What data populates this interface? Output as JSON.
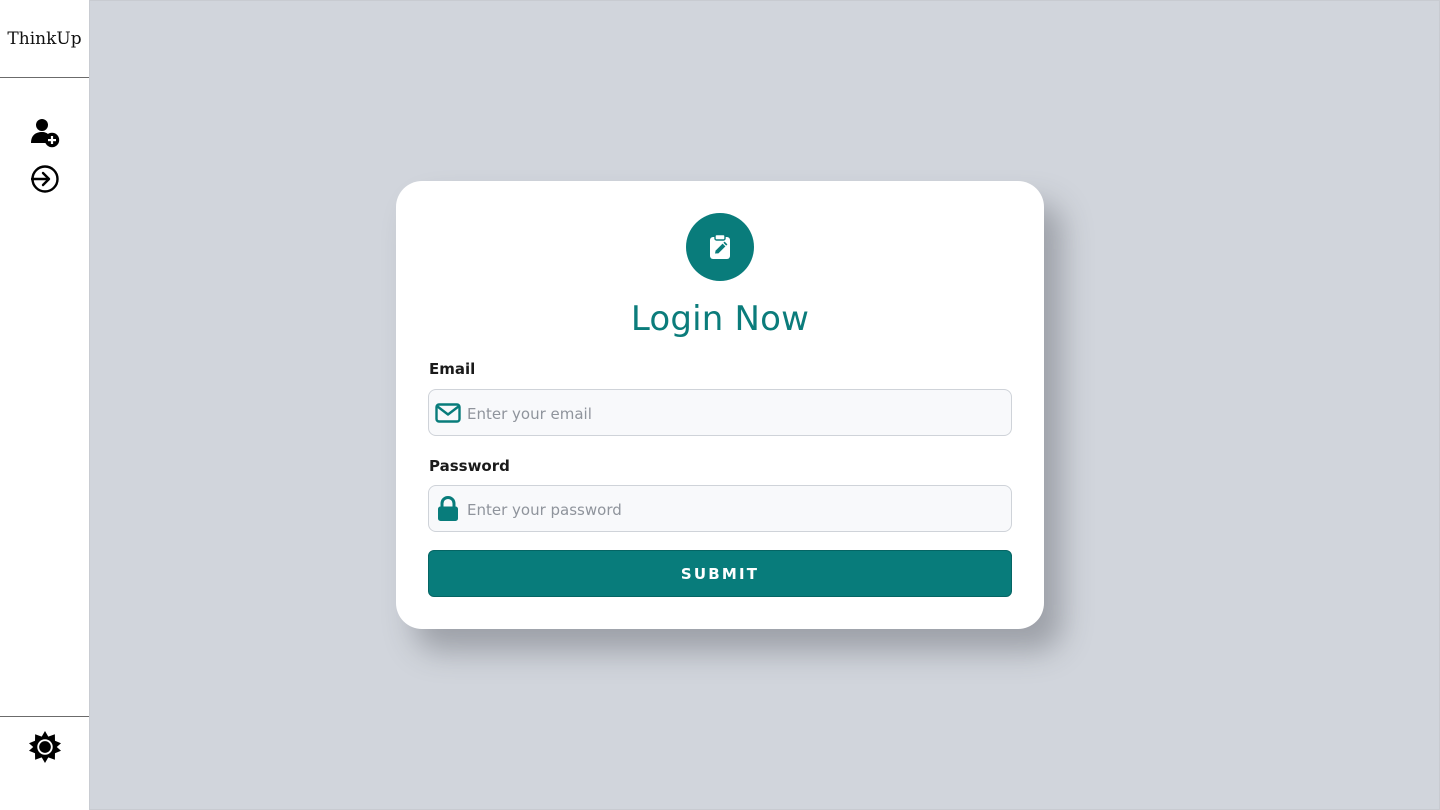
{
  "sidebar": {
    "brand": "ThinkUp",
    "icons": {
      "register": "user-plus-icon",
      "login": "sign-in-icon",
      "theme": "sun-icon"
    }
  },
  "login": {
    "badge_icon": "clipboard-edit-icon",
    "title": "Login Now",
    "email": {
      "label": "Email",
      "placeholder": "Enter your email",
      "value": "",
      "icon": "envelope-icon"
    },
    "password": {
      "label": "Password",
      "placeholder": "Enter your password",
      "value": "",
      "icon": "lock-icon"
    },
    "submit_label": "SUBMIT"
  },
  "colors": {
    "accent": "#087c7b",
    "background": "#d1d5dc",
    "card": "#ffffff"
  }
}
